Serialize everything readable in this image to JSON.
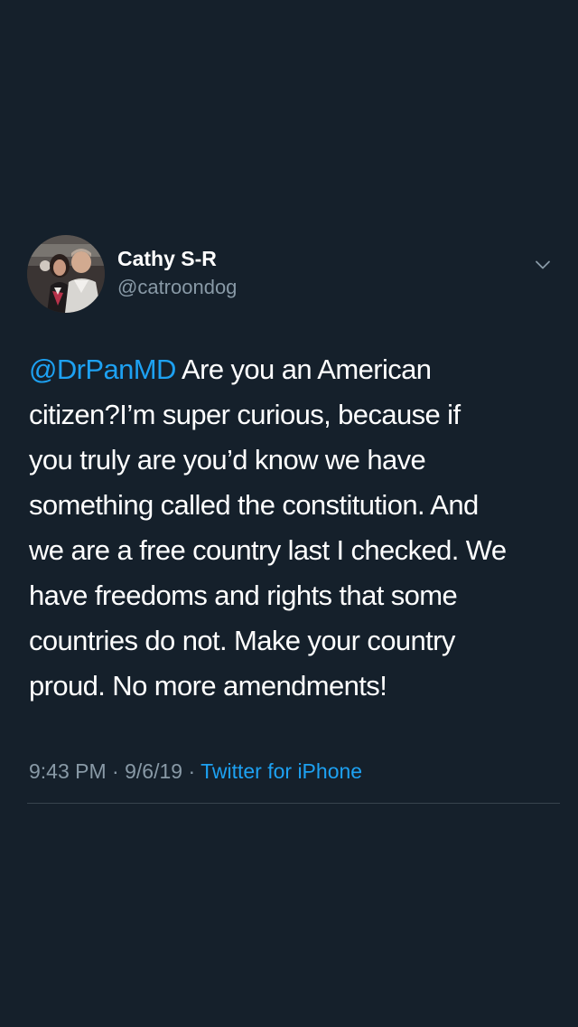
{
  "tweet": {
    "author": {
      "display_name": "Cathy S-R",
      "handle": "@catroondog"
    },
    "menu_icon": "chevron-down-icon",
    "body": {
      "mention": "@DrPanMD",
      "lines": [
        " Are you an American",
        "citizen?I’m super curious, because if",
        "you truly are you’d know we have",
        "something called the constitution.  And",
        "we are a free country last I checked.  We",
        "have freedoms and rights that some",
        "countries do not. Make your country",
        "proud. No more amendments!"
      ]
    },
    "meta": {
      "time": "9:43 PM",
      "separator": " · ",
      "date": "9/6/19",
      "source": "Twitter for iPhone"
    }
  },
  "colors": {
    "background": "#15202b",
    "link": "#1da1f2",
    "secondary_text": "#8899a6",
    "divider": "#38444d"
  }
}
